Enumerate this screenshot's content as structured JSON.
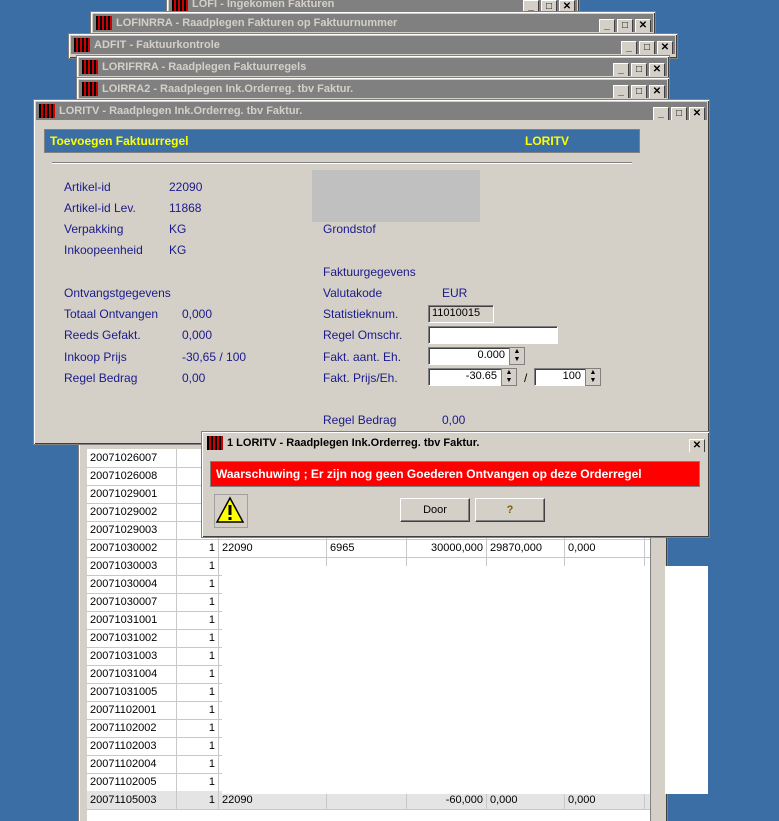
{
  "bg_windows": [
    {
      "title": "LOFI - Ingekomen Fakturen"
    },
    {
      "title": "LOFINRRA - Raadplegen Fakturen op Faktuurnummer"
    },
    {
      "title": "ADFIT - Faktuurkontrole"
    },
    {
      "title": "LORIFRRA - Raadplegen Faktuurregels"
    },
    {
      "title": "LOIRRA2 - Raadplegen Ink.Orderreg. tbv Faktur."
    }
  ],
  "main_window": {
    "title": "LORITV - Raadplegen Ink.Orderreg. tbv Faktur.",
    "header_left": "Toevoegen Faktuurregel",
    "header_right": "LORITV",
    "fields": {
      "artikel_id_label": "Artikel-id",
      "artikel_id": "22090",
      "artikel_id_lev_label": "Artikel-id Lev.",
      "artikel_id_lev": "11868",
      "verpakking_label": "Verpakking",
      "verpakking": "KG",
      "inkoopeenheid_label": "Inkoopeenheid",
      "inkoopeenheid": "KG",
      "grondstof_label": "Grondstof",
      "faktuurgegevens_label": "Faktuurgegevens",
      "ontvangst_label": "Ontvangstgegevens",
      "totaal_ontv_label": "Totaal Ontvangen",
      "totaal_ontv": "0,000",
      "reeds_gefakt_label": "Reeds  Gefakt.",
      "reeds_gefakt": "0,000",
      "inkoop_prijs_label": "Inkoop Prijs",
      "inkoop_prijs": "-30,65 / 100",
      "regel_bedrag_label": "Regel Bedrag",
      "regel_bedrag": "0,00",
      "valutakode_label": "Valutakode",
      "valutakode": "EUR",
      "statistieknum_label": "Statistieknum.",
      "statistieknum": "11010015",
      "regel_omschr_label": "Regel Omschr.",
      "regel_omschr": "",
      "fakt_aant_label": "Fakt.  aant. Eh.",
      "fakt_aant": "0.000",
      "fakt_prijs_label": "Fakt. Prijs/Eh.",
      "fakt_prijs": "-30.65",
      "slash": "/",
      "fakt_per": "100",
      "regel_bedrag2_label": "Regel Bedrag",
      "regel_bedrag2": "0,00"
    }
  },
  "dialog": {
    "title": "1 LORITV - Raadplegen Ink.Orderreg. tbv Faktur.",
    "message": "Waarschuwing ; Er zijn nog geen Goederen Ontvangen op deze Orderregel",
    "door_label": "Door",
    "help_label": "?"
  },
  "grid_rows": [
    {
      "c1": "20071026007",
      "c2": "",
      "c3": "",
      "c4": "",
      "c5": "",
      "c6": "",
      "c7": ""
    },
    {
      "c1": "20071026008",
      "c2": "",
      "c3": "",
      "c4": "",
      "c5": "",
      "c6": "",
      "c7": ""
    },
    {
      "c1": "20071029001",
      "c2": "",
      "c3": "",
      "c4": "",
      "c5": "",
      "c6": "",
      "c7": ""
    },
    {
      "c1": "20071029002",
      "c2": "",
      "c3": "",
      "c4": "",
      "c5": "",
      "c6": "",
      "c7": ""
    },
    {
      "c1": "20071029003",
      "c2": "",
      "c3": "",
      "c4": "",
      "c5": "",
      "c6": "",
      "c7": ""
    },
    {
      "c1": "20071030002",
      "c2": "1",
      "c3": "22090",
      "c4": "6965",
      "c5": "30000,000",
      "c6": "29870,000",
      "c7": "0,000"
    },
    {
      "c1": "20071030003",
      "c2": "1",
      "c3": "",
      "c4": "",
      "c5": "",
      "c6": "",
      "c7": ""
    },
    {
      "c1": "20071030004",
      "c2": "1",
      "c3": "",
      "c4": "",
      "c5": "",
      "c6": "",
      "c7": ""
    },
    {
      "c1": "20071030007",
      "c2": "1",
      "c3": "",
      "c4": "",
      "c5": "",
      "c6": "",
      "c7": ""
    },
    {
      "c1": "20071031001",
      "c2": "1",
      "c3": "",
      "c4": "",
      "c5": "",
      "c6": "",
      "c7": ""
    },
    {
      "c1": "20071031002",
      "c2": "1",
      "c3": "",
      "c4": "",
      "c5": "",
      "c6": "",
      "c7": ""
    },
    {
      "c1": "20071031003",
      "c2": "1",
      "c3": "",
      "c4": "",
      "c5": "",
      "c6": "",
      "c7": ""
    },
    {
      "c1": "20071031004",
      "c2": "1",
      "c3": "",
      "c4": "",
      "c5": "",
      "c6": "",
      "c7": ""
    },
    {
      "c1": "20071031005",
      "c2": "1",
      "c3": "",
      "c4": "",
      "c5": "",
      "c6": "",
      "c7": ""
    },
    {
      "c1": "20071102001",
      "c2": "1",
      "c3": "",
      "c4": "",
      "c5": "",
      "c6": "",
      "c7": ""
    },
    {
      "c1": "20071102002",
      "c2": "1",
      "c3": "",
      "c4": "",
      "c5": "",
      "c6": "",
      "c7": ""
    },
    {
      "c1": "20071102003",
      "c2": "1",
      "c3": "",
      "c4": "",
      "c5": "",
      "c6": "",
      "c7": ""
    },
    {
      "c1": "20071102004",
      "c2": "1",
      "c3": "",
      "c4": "",
      "c5": "",
      "c6": "",
      "c7": ""
    },
    {
      "c1": "20071102005",
      "c2": "1",
      "c3": "",
      "c4": "",
      "c5": "",
      "c6": "",
      "c7": ""
    },
    {
      "c1": "20071105003",
      "c2": "1",
      "c3": "22090",
      "c4": "",
      "c5": "-60,000",
      "c6": "0,000",
      "c7": "0,000"
    }
  ],
  "colors": {
    "desktop": "#3a6ea5",
    "header_bar": "#3a6ea5",
    "header_text": "#ffff00",
    "warning": "#ff0000",
    "label": "#1a1a8a"
  }
}
